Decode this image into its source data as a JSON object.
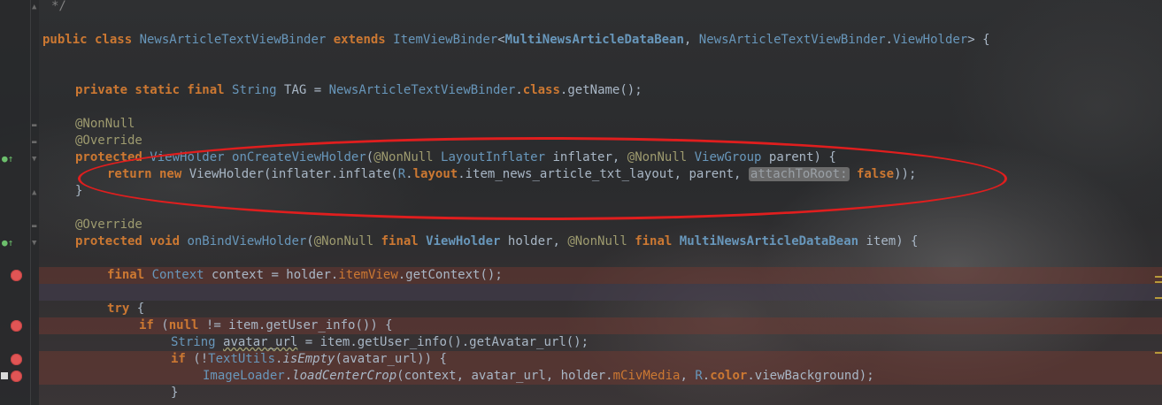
{
  "editor": {
    "lines": {
      "l0": "*/",
      "l1": "public class NewsArticleTextViewBinder extends ItemViewBinder<MultiNewsArticleDataBean, NewsArticleTextViewBinder.ViewHolder> {",
      "l3": "private static final String TAG = NewsArticleTextViewBinder.class.getName();",
      "l5": "@NonNull",
      "l6": "@Override",
      "l7a": "protected ViewHolder onCreateViewHolder(@NonNull LayoutInflater inflater, @NonNull ViewGroup parent) {",
      "l8a": "return new ViewHolder(inflater.inflate(R.layout.item_news_article_txt_layout, parent, ",
      "l8hint": "attachToRoot:",
      "l8b": "false));",
      "l9": "}",
      "l11": "@Override",
      "l12": "protected void onBindViewHolder(@NonNull final ViewHolder holder, @NonNull final MultiNewsArticleDataBean item) {",
      "l14": "final Context context = holder.itemView.getContext();",
      "l16": "try {",
      "l17": "if (null != item.getUser_info()) {",
      "l18": "String avatar_url = item.getUser_info().getAvatar_url();",
      "l19": "if (!TextUtils.isEmpty(avatar_url)) {",
      "l20": "ImageLoader.loadCenterCrop(context, avatar_url, holder.mCivMedia, R.color.viewBackground);",
      "l21": "}"
    }
  },
  "colors": {
    "keyword": "#cc7832",
    "annotation": "#9e9b6f",
    "method": "#ffc66d",
    "breakpoint": "#e05555",
    "highlight_ellipse": "#e01e1e"
  },
  "icons": {
    "breakpoint": "breakpoint-icon",
    "override": "override-method-icon",
    "fold": "fold-marker-icon",
    "lock": "lock-icon"
  }
}
